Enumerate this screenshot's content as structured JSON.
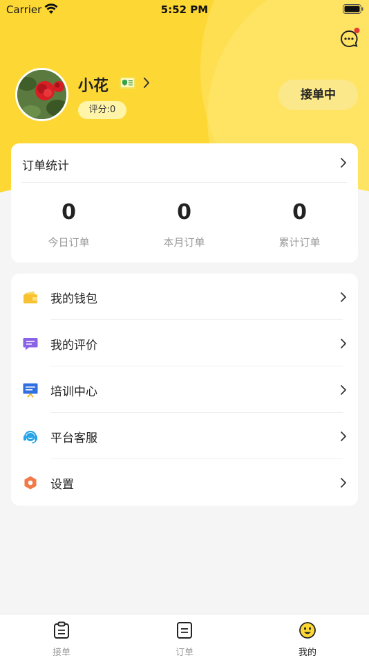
{
  "status_bar": {
    "carrier": "Carrier",
    "time": "5:52 PM"
  },
  "profile": {
    "name": "小花",
    "score": "评分:0",
    "status_button": "接单中"
  },
  "stats": {
    "title": "订单统计",
    "items": [
      {
        "value": "0",
        "label": "今日订单"
      },
      {
        "value": "0",
        "label": "本月订单"
      },
      {
        "value": "0",
        "label": "累计订单"
      }
    ]
  },
  "menu": {
    "items": [
      {
        "label": "我的钱包",
        "icon": "wallet-icon"
      },
      {
        "label": "我的评价",
        "icon": "review-icon"
      },
      {
        "label": "培训中心",
        "icon": "training-icon"
      },
      {
        "label": "平台客服",
        "icon": "customer-service-icon"
      },
      {
        "label": "设置",
        "icon": "settings-icon"
      }
    ]
  },
  "tabs": [
    {
      "label": "接单",
      "icon": "clipboard-icon",
      "active": false
    },
    {
      "label": "订单",
      "icon": "document-icon",
      "active": false
    },
    {
      "label": "我的",
      "icon": "smiley-icon",
      "active": true
    }
  ],
  "colors": {
    "accent": "#fdd835",
    "status_button": "#fbe88a",
    "notification_dot": "#e53935"
  }
}
